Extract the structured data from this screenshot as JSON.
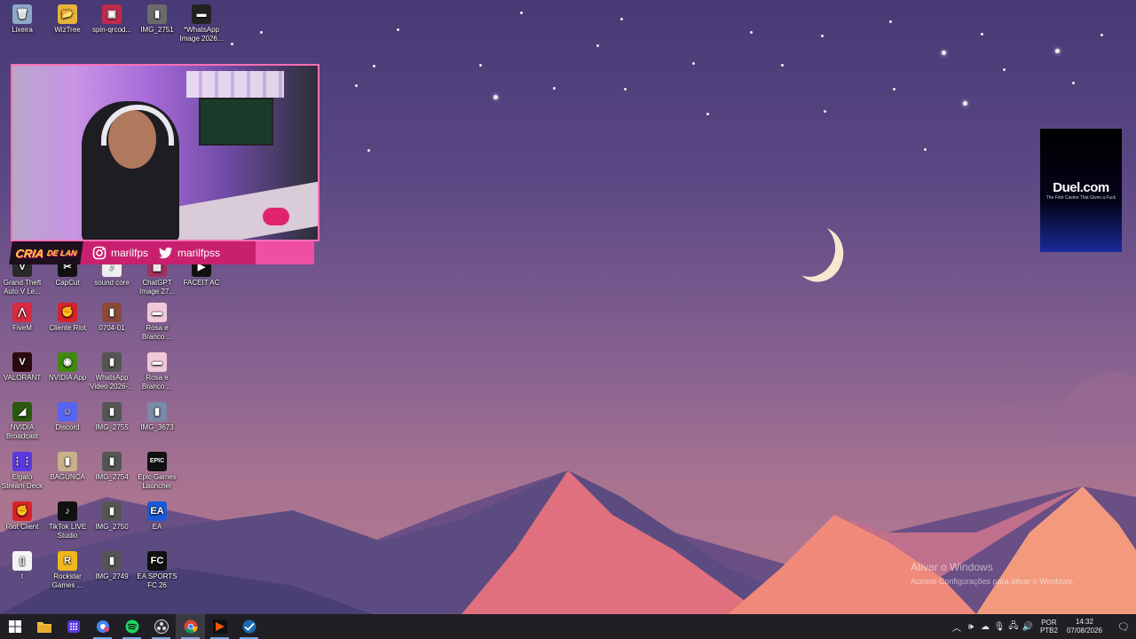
{
  "desktop_icons": [
    {
      "label": "Lixeira",
      "glyph": "🗑",
      "color": "#8fa8c8"
    },
    {
      "label": "WizTree",
      "glyph": "📂",
      "color": "#e8b33a"
    },
    {
      "label": "spin-qrcod...",
      "glyph": "▣",
      "color": "#c22a4b"
    },
    {
      "label": "IMG_2751",
      "glyph": "▮",
      "color": "#6b6b6b"
    },
    {
      "label": "*WhatsApp Image 2026...",
      "glyph": "▬",
      "color": "#222"
    },
    {
      "label": "Grand Theft Auto V Le...",
      "glyph": "V",
      "color": "#2a2a2a"
    },
    {
      "label": "CapCut",
      "glyph": "✂",
      "color": "#111"
    },
    {
      "label": "sound core",
      "glyph": "♪",
      "color": "#eee"
    },
    {
      "label": "ChatGPT Image 27...",
      "glyph": "▦",
      "color": "#a03060"
    },
    {
      "label": "FACEIT AC",
      "glyph": "▶",
      "color": "#111"
    },
    {
      "label": "FiveM",
      "glyph": "⋀",
      "color": "#d82a40"
    },
    {
      "label": "Cliente Riot",
      "glyph": "✊",
      "color": "#d8232a"
    },
    {
      "label": "0704-01",
      "glyph": "▮",
      "color": "#8a4a3a"
    },
    {
      "label": "Rosa e Branco ...",
      "glyph": "▬",
      "color": "#f0c8d8"
    },
    {
      "label": "VALORANT",
      "glyph": "V",
      "color": "#2a0a10"
    },
    {
      "label": "NVIDIA App",
      "glyph": "◉",
      "color": "#3f8a10"
    },
    {
      "label": "WhatsApp Video 2026-...",
      "glyph": "▮",
      "color": "#555"
    },
    {
      "label": "Rosa e Branco ...",
      "glyph": "▬",
      "color": "#f0c8d8"
    },
    {
      "label": "NVIDIA Broadcast",
      "glyph": "◢",
      "color": "#2a5a10"
    },
    {
      "label": "Discord",
      "glyph": "☺",
      "color": "#5865f2"
    },
    {
      "label": "IMG_2755",
      "glyph": "▮",
      "color": "#555"
    },
    {
      "label": "IMG_3673",
      "glyph": "▮",
      "color": "#7a8aa8"
    },
    {
      "label": "Elgato Stream Deck",
      "glyph": "⋮⋮",
      "color": "#5a3ae0"
    },
    {
      "label": "BAGUNÇA",
      "glyph": "▮",
      "color": "#c8b08a"
    },
    {
      "label": "IMG_2754",
      "glyph": "▮",
      "color": "#555"
    },
    {
      "label": "Epic Games Launcher",
      "glyph": "EPIC",
      "color": "#111"
    },
    {
      "label": "Riot Client",
      "glyph": "✊",
      "color": "#d8232a"
    },
    {
      "label": "TikTok LIVE Studio",
      "glyph": "♪",
      "color": "#111"
    },
    {
      "label": "IMG_2750",
      "glyph": "▮",
      "color": "#555"
    },
    {
      "label": "EA",
      "glyph": "EA",
      "color": "#1a5ad8"
    },
    {
      "label": "t",
      "glyph": "▯",
      "color": "#f4f4f4"
    },
    {
      "label": "Rockstar Games ...",
      "glyph": "R",
      "color": "#f0b81a"
    },
    {
      "label": "IMG_2749",
      "glyph": "▮",
      "color": "#555"
    },
    {
      "label": "EA SPORTS FC 26",
      "glyph": "FC",
      "color": "#111"
    }
  ],
  "overlay": {
    "brand_line1": "CRIA",
    "brand_line2": "DE LAN",
    "instagram_handle": "marilfps",
    "twitter_handle": "marilfpss"
  },
  "ad": {
    "logo": "Duel.com",
    "tagline": "The First Casino That Gives a Fuck"
  },
  "watermark": {
    "title": "Ativar o Windows",
    "subtitle": "Acesse Configurações para ativar o Windows."
  },
  "taskbar": {
    "apps": [
      {
        "name": "start",
        "glyph": "⊞"
      },
      {
        "name": "file-explorer",
        "glyph": "📁"
      },
      {
        "name": "stream-deck",
        "glyph": "⋮⋮"
      },
      {
        "name": "chrome-profile",
        "glyph": "◎"
      },
      {
        "name": "spotify",
        "glyph": "≋"
      },
      {
        "name": "obs",
        "glyph": "◉"
      },
      {
        "name": "chrome",
        "glyph": "◕"
      },
      {
        "name": "faceit",
        "glyph": "▶"
      },
      {
        "name": "steam",
        "glyph": "✔"
      }
    ],
    "tray": {
      "lang_line1": "POR",
      "lang_line2": "PTB2",
      "time": "14:32",
      "date": "07/08/2026"
    }
  },
  "colors": {
    "overlay_pink": "#c8206f",
    "overlay_border": "#ff6fb4",
    "taskbar_bg": "#1f1f24"
  }
}
